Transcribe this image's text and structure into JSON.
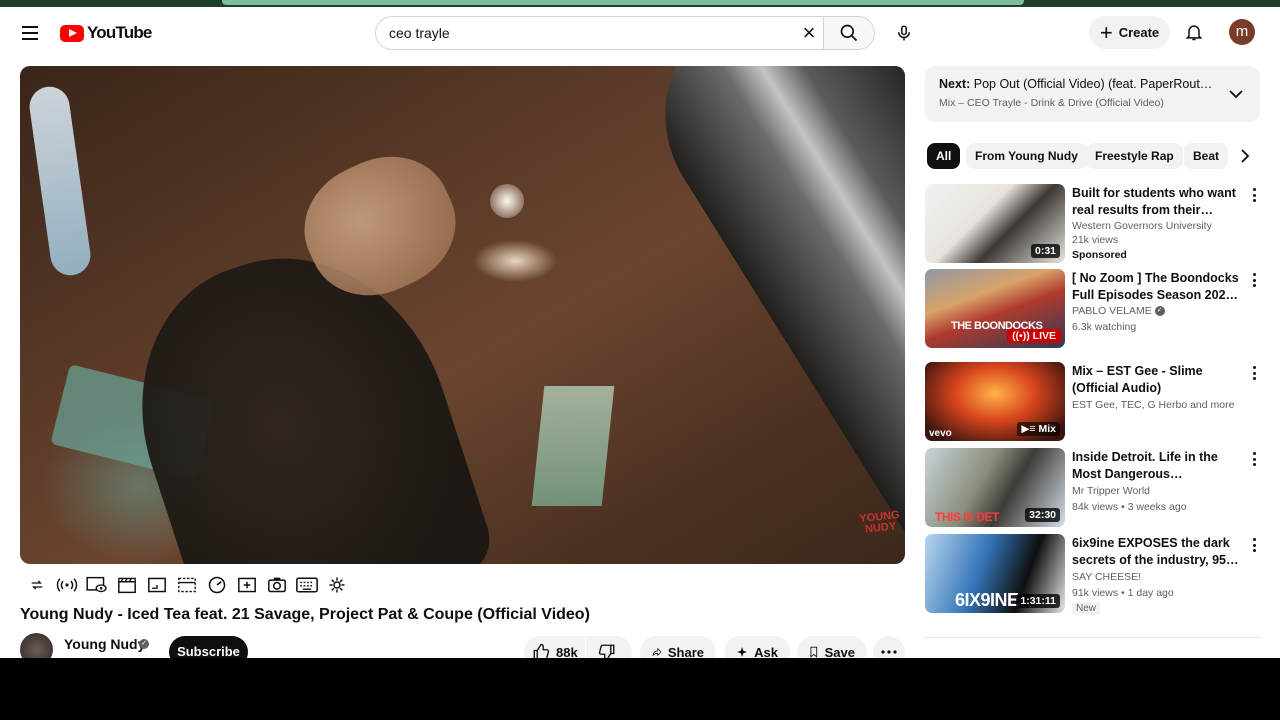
{
  "header": {
    "logo_text": "YouTube",
    "search_value": "ceo trayle",
    "clear_glyph": "×",
    "create_label": "Create",
    "avatar_letter": "m"
  },
  "player": {
    "watermark_line1": "YOUNG",
    "watermark_line2": "NUDY"
  },
  "controls": [
    "loop-icon",
    "broadcast-icon",
    "eye-settings-icon",
    "clapper-icon",
    "frame-icon",
    "mini-player-icon",
    "speed-icon",
    "add-icon",
    "camera-icon",
    "keyboard-icon",
    "gear-icon"
  ],
  "video": {
    "title": "Young Nudy - Iced Tea feat. 21 Savage, Project Pat & Coupe (Official Video)",
    "channel": "Young Nudy",
    "subscribe_label": "Subscribe",
    "likes": "88k",
    "share_label": "Share",
    "ask_label": "Ask",
    "save_label": "Save"
  },
  "next": {
    "prefix": "Next:",
    "title": "Pop Out (Official Video) (feat. PaperRoute Wo...",
    "subtitle": "Mix – CEO Trayle - Drink & Drive (Official Video)"
  },
  "chips": [
    "All",
    "From Young Nudy",
    "Freestyle Rap",
    "Beat"
  ],
  "recommendations": [
    {
      "title": "Built for students who want real results from their education",
      "channel": "Western Governors University",
      "stats": "21k views",
      "tag": "Sponsored",
      "duration": "0:31"
    },
    {
      "title": "[ No Zoom ] The Boondocks Full Episodes Season 2025 🔴 ...",
      "channel": "PABLO VELAME",
      "stats": "6.3k watching",
      "badge": "LIVE",
      "thumb_text": "THE BOONDOCKS"
    },
    {
      "title": "Mix – EST Gee - Slime (Official Audio)",
      "channel": "EST Gee, TEC, G Herbo and more",
      "badge": "Mix",
      "thumb_text": "vevo"
    },
    {
      "title": "Inside Detroit. Life in the Most Dangerous Neighborhoods",
      "channel": "Mr Tripper World",
      "stats": "84k views • 3 weeks ago",
      "duration": "32:30",
      "thumb_text": "THIS IS DET"
    },
    {
      "title": "6ix9ine EXPOSES the dark secrets of the industry, 95% of ...",
      "channel": "SAY CHEESE!",
      "stats": "91k views • 1 day ago",
      "tag": "New",
      "duration": "1:31:11",
      "thumb_text": "6IX9INE"
    }
  ],
  "colors": {
    "brand_red": "#ff0000",
    "live_red": "#cc0000",
    "chip_bg": "#f2f2f2",
    "text_primary": "#0f0f0f",
    "text_secondary": "#606060"
  }
}
